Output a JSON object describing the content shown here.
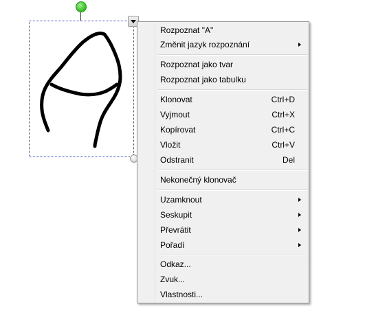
{
  "context_menu": {
    "items": [
      {
        "label": "Rozpoznat \"A\"",
        "shortcut": "",
        "submenu": false
      },
      {
        "label": "Změnit jazyk rozpoznání",
        "shortcut": "",
        "submenu": true
      },
      {
        "label": "Rozpoznat jako tvar",
        "shortcut": "",
        "submenu": false
      },
      {
        "label": "Rozpoznat jako tabulku",
        "shortcut": "",
        "submenu": false
      },
      {
        "label": "Klonovat",
        "shortcut": "Ctrl+D",
        "submenu": false
      },
      {
        "label": "Vyjmout",
        "shortcut": "Ctrl+X",
        "submenu": false
      },
      {
        "label": "Kopírovat",
        "shortcut": "Ctrl+C",
        "submenu": false
      },
      {
        "label": "Vložit",
        "shortcut": "Ctrl+V",
        "submenu": false
      },
      {
        "label": "Odstranit",
        "shortcut": "Del",
        "submenu": false
      },
      {
        "label": "Nekonečný klonovač",
        "shortcut": "",
        "submenu": false
      },
      {
        "label": "Uzamknout",
        "shortcut": "",
        "submenu": true
      },
      {
        "label": "Seskupit",
        "shortcut": "",
        "submenu": true
      },
      {
        "label": "Převrátit",
        "shortcut": "",
        "submenu": true
      },
      {
        "label": "Pořadí",
        "shortcut": "",
        "submenu": true
      },
      {
        "label": "Odkaz...",
        "shortcut": "",
        "submenu": false
      },
      {
        "label": "Zvuk...",
        "shortcut": "",
        "submenu": false
      },
      {
        "label": "Vlastnosti...",
        "shortcut": "",
        "submenu": false
      }
    ]
  },
  "colors": {
    "selection_border": "#2a3bb7",
    "rotate_handle": "#47c531",
    "menu_background": "#f0f0f0",
    "ink": "#000000"
  },
  "icons": {
    "rotate_handle": "green-circle-handle",
    "menu_toggle": "triangle-down-icon",
    "resize_handle": "grey-circle-handle",
    "submenu_arrow": "triangle-right-icon"
  }
}
